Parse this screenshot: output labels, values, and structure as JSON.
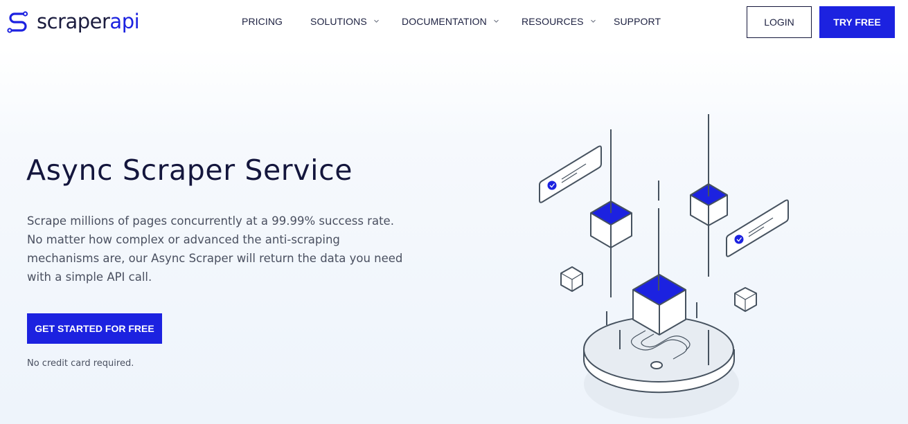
{
  "brand": {
    "name_part1": "scraper",
    "name_part2": "api",
    "accent_color": "#1c22e0",
    "dark_color": "#14163d"
  },
  "nav": {
    "items": [
      {
        "label": "PRICING",
        "has_dropdown": false
      },
      {
        "label": "SOLUTIONS",
        "has_dropdown": true
      },
      {
        "label": "DOCUMENTATION",
        "has_dropdown": true
      },
      {
        "label": "RESOURCES",
        "has_dropdown": true
      },
      {
        "label": "SUPPORT",
        "has_dropdown": false
      }
    ],
    "login_label": "LOGIN",
    "try_free_label": "TRY FREE"
  },
  "hero": {
    "title": "Async Scraper Service",
    "description": "Scrape millions of pages concurrently at a 99.99% success rate. No matter how complex or advanced the anti-scraping mechanisms are, our Async Scraper will return the data you need with a simple API call.",
    "cta_label": "GET STARTED FOR FREE",
    "note": "No credit card required.",
    "illustration": "isometric-cubes-platform-illustration"
  }
}
